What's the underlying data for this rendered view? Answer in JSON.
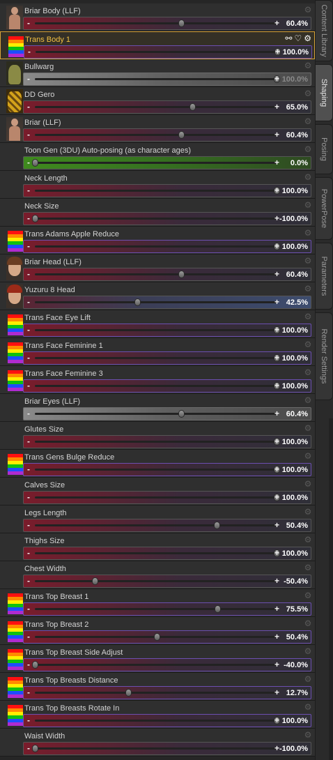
{
  "tabs": [
    {
      "label": "Content Library",
      "active": false
    },
    {
      "label": "Shaping",
      "active": true
    },
    {
      "label": "Posing",
      "active": false
    },
    {
      "label": "PowerPose",
      "active": false
    },
    {
      "label": "Parameters",
      "active": false
    },
    {
      "label": "Render Settings",
      "active": false
    }
  ],
  "rows": [
    {
      "label": "Briar Body (LLF)",
      "value": "60.4%",
      "fraction": 0.604,
      "thumb": "person",
      "track": "red"
    },
    {
      "label": "Trans Body 1",
      "value": "100.0%",
      "fraction": 1.0,
      "thumb": "rainbow",
      "track": "purple",
      "selected": true
    },
    {
      "label": "Bullwarg",
      "value": "100.0%",
      "fraction": 1.0,
      "thumb": "creature",
      "track": "grey",
      "dim": true
    },
    {
      "label": "DD Gero",
      "value": "65.0%",
      "fraction": 0.65,
      "thumb": "gero",
      "track": "red"
    },
    {
      "label": "Briar (LLF)",
      "value": "60.4%",
      "fraction": 0.604,
      "thumb": "person",
      "track": "red"
    },
    {
      "label": "Toon Gen (3DU) Auto-posing (as character ages)",
      "value": "0.0%",
      "fraction": 0.0,
      "thumb": "none",
      "track": "green"
    },
    {
      "label": "Neck Length",
      "value": "100.0%",
      "fraction": 1.0,
      "thumb": "none",
      "track": "red"
    },
    {
      "label": "Neck Size",
      "value": "-100.0%",
      "fraction": 0.0,
      "thumb": "none",
      "track": "red"
    },
    {
      "label": "Trans Adams Apple Reduce",
      "value": "100.0%",
      "fraction": 1.0,
      "thumb": "rainbow",
      "track": "purple"
    },
    {
      "label": "Briar Head (LLF)",
      "value": "60.4%",
      "fraction": 0.604,
      "thumb": "face",
      "track": "red"
    },
    {
      "label": "Yuzuru 8 Head",
      "value": "42.5%",
      "fraction": 0.425,
      "thumb": "face-red",
      "track": "blue"
    },
    {
      "label": "Trans Face Eye Lift",
      "value": "100.0%",
      "fraction": 1.0,
      "thumb": "rainbow",
      "track": "purple"
    },
    {
      "label": "Trans Face Feminine 1",
      "value": "100.0%",
      "fraction": 1.0,
      "thumb": "rainbow",
      "track": "purple"
    },
    {
      "label": "Trans Face Feminine 3",
      "value": "100.0%",
      "fraction": 1.0,
      "thumb": "rainbow",
      "track": "purple"
    },
    {
      "label": "Briar Eyes (LLF)",
      "value": "60.4%",
      "fraction": 0.604,
      "thumb": "none",
      "track": "grey"
    },
    {
      "label": "Glutes Size",
      "value": "100.0%",
      "fraction": 1.0,
      "thumb": "none",
      "track": "red"
    },
    {
      "label": "Trans Gens Bulge Reduce",
      "value": "100.0%",
      "fraction": 1.0,
      "thumb": "rainbow",
      "track": "purple"
    },
    {
      "label": "Calves Size",
      "value": "100.0%",
      "fraction": 1.0,
      "thumb": "none",
      "track": "red"
    },
    {
      "label": "Legs Length",
      "value": "50.4%",
      "fraction": 0.752,
      "thumb": "none",
      "track": "red"
    },
    {
      "label": "Thighs Size",
      "value": "100.0%",
      "fraction": 1.0,
      "thumb": "none",
      "track": "red"
    },
    {
      "label": "Chest Width",
      "value": "-50.4%",
      "fraction": 0.248,
      "thumb": "none",
      "track": "red"
    },
    {
      "label": "Trans Top Breast 1",
      "value": "75.5%",
      "fraction": 0.755,
      "thumb": "rainbow",
      "track": "purple"
    },
    {
      "label": "Trans Top Breast 2",
      "value": "50.4%",
      "fraction": 0.504,
      "thumb": "rainbow",
      "track": "purple"
    },
    {
      "label": "Trans Top Breast Side Adjust",
      "value": "-40.0%",
      "fraction": 0.0,
      "thumb": "rainbow",
      "track": "purple"
    },
    {
      "label": "Trans Top Breasts Distance",
      "value": "12.7%",
      "fraction": 0.385,
      "thumb": "rainbow",
      "track": "purple"
    },
    {
      "label": "Trans Top Breasts Rotate In",
      "value": "100.0%",
      "fraction": 1.0,
      "thumb": "rainbow",
      "track": "purple"
    },
    {
      "label": "Waist Width",
      "value": "-100.0%",
      "fraction": 0.0,
      "thumb": "none",
      "track": "red"
    }
  ],
  "icons": {
    "gear": "gear-icon",
    "minus": "−",
    "plus": "+",
    "link": "link-icon",
    "heart": "heart-icon"
  }
}
